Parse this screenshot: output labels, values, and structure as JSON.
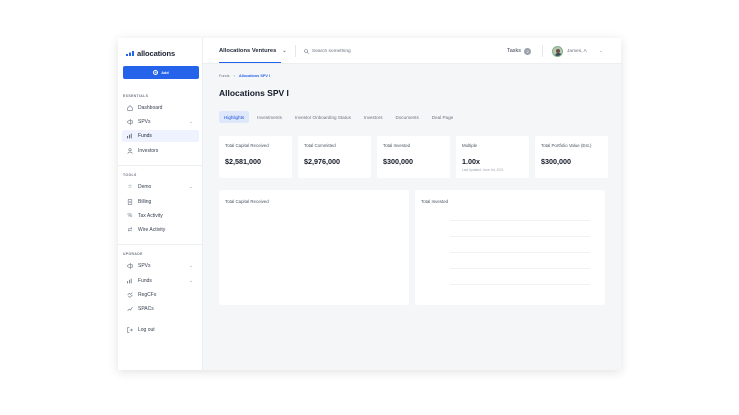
{
  "app": {
    "logo_text": "allocations",
    "add_button": "Add"
  },
  "sidebar": {
    "essentials_label": "ESSENTIALS",
    "essentials": [
      {
        "label": "Dashboard",
        "icon": "home-icon"
      },
      {
        "label": "SPVs",
        "icon": "megaphone-icon",
        "expandable": true
      },
      {
        "label": "Funds",
        "icon": "chart-icon",
        "active": true
      },
      {
        "label": "Investors",
        "icon": "person-icon"
      }
    ],
    "tools_label": "TOOLS",
    "tools": [
      {
        "label": "Demo",
        "icon": "star-icon",
        "expandable": true
      },
      {
        "label": "Billing",
        "icon": "document-icon"
      },
      {
        "label": "Tax Activity",
        "icon": "percent-icon"
      },
      {
        "label": "Wire Activity",
        "icon": "transfer-icon"
      }
    ],
    "upgrade_label": "UPGRADE",
    "upgrade": [
      {
        "label": "SPVs",
        "icon": "megaphone-icon",
        "expandable": true
      },
      {
        "label": "Funds",
        "icon": "chart-icon",
        "expandable": true
      },
      {
        "label": "RegCFs",
        "icon": "handshake-icon"
      },
      {
        "label": "SPACs",
        "icon": "trend-icon"
      }
    ],
    "logout": "Log out"
  },
  "header": {
    "org_name": "Allocations Ventures",
    "search_placeholder": "Search something",
    "tasks_label": "Tasks",
    "tasks_count": "2",
    "user_name": "James, A"
  },
  "breadcrumb": {
    "parent": "Funds",
    "separator": "›",
    "current": "Allocations SPV I"
  },
  "page_title": "Allocations SPV I",
  "tabs": [
    "Highlights",
    "Investments",
    "Investor Onboarding Status",
    "Investors",
    "Documents",
    "Deal Page"
  ],
  "active_tab": "Highlights",
  "metrics": [
    {
      "label": "Total Capital Received",
      "value": "$2,581,000",
      "sub": ""
    },
    {
      "label": "Total Committed",
      "value": "$2,976,000",
      "sub": ""
    },
    {
      "label": "Total Invested",
      "value": "$300,000",
      "sub": ""
    },
    {
      "label": "Multiple",
      "value": "1.00x",
      "sub": "Last Updated: June 1st, 2021"
    },
    {
      "label": "Total Portfolio Value (Est.)",
      "value": "$300,000",
      "sub": ""
    }
  ],
  "panels": {
    "left_title": "Total Capital Received",
    "right_title": "Total Invested"
  },
  "colors": {
    "accent": "#2563eb",
    "active_bg": "#eef3ff",
    "tab_active_bg": "#dfe8fb"
  }
}
